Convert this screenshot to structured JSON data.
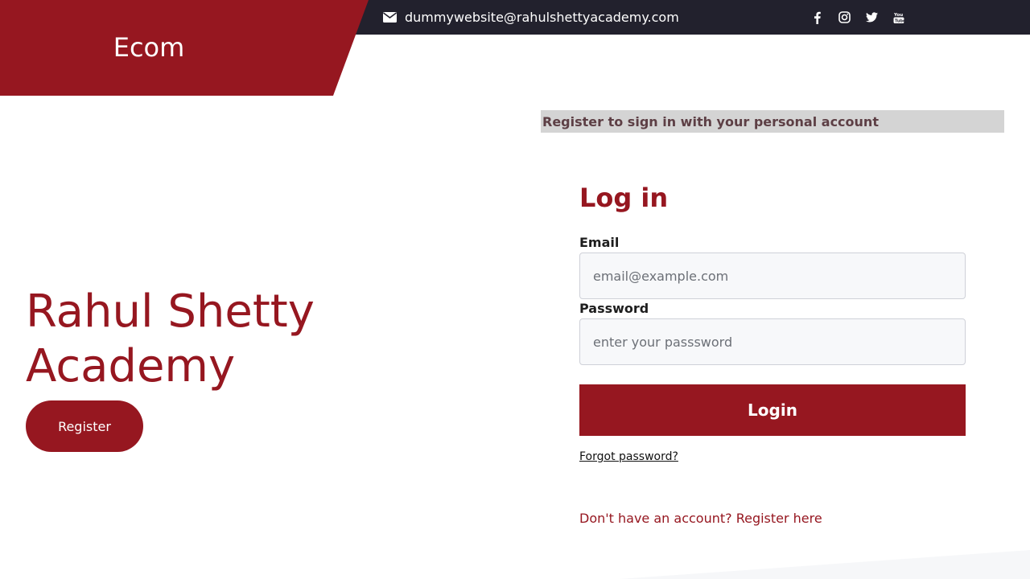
{
  "brand": {
    "name": "Ecom"
  },
  "topbar": {
    "email": "dummywebsite@rahulshettyacademy.com",
    "social_icons": [
      "facebook-icon",
      "instagram-icon",
      "twitter-icon",
      "youtube-icon"
    ]
  },
  "hero": {
    "title": "Rahul Shetty Academy",
    "register_label": "Register"
  },
  "banner": {
    "text": "Register to sign in with your personal account"
  },
  "login": {
    "heading": "Log in",
    "email_label": "Email",
    "email_placeholder": "email@example.com",
    "password_label": "Password",
    "password_placeholder": "enter your passsword",
    "submit_label": "Login",
    "forgot_label": "Forgot password?",
    "signup_label": "Don't have an account? Register here"
  },
  "colors": {
    "brand_red": "#961720",
    "topbar_dark": "#22212d",
    "banner_gray": "#d4d4d4"
  }
}
